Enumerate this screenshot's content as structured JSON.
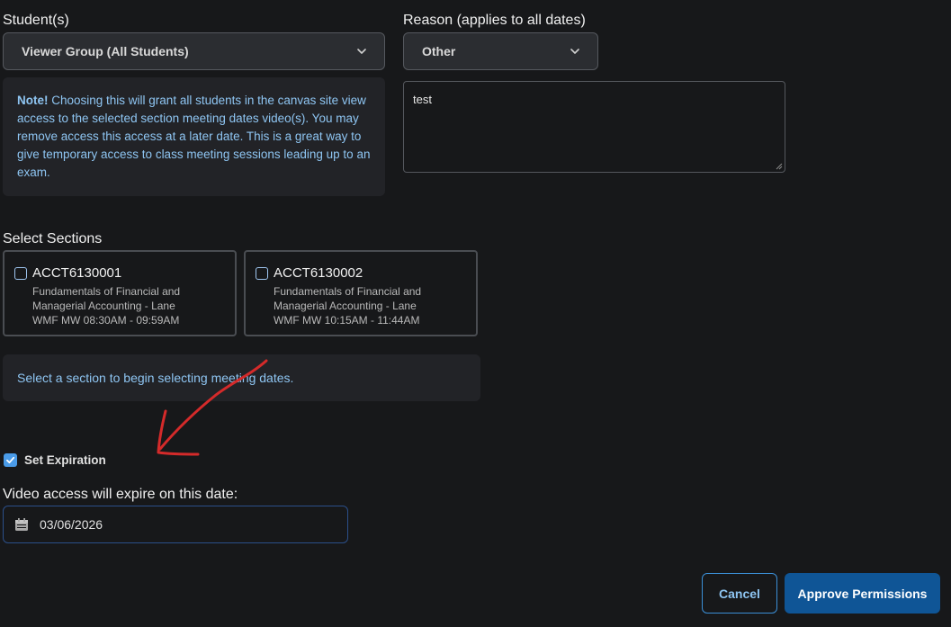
{
  "students": {
    "label": "Student(s)",
    "selected": "Viewer Group (All Students)",
    "note_strong": "Note!",
    "note_text": " Choosing this will grant all students in the canvas site view access to the selected section meeting dates video(s). You may remove access this access at a later date. This is a great way to give temporary access to class meeting sessions leading up to an exam."
  },
  "reason": {
    "label": "Reason (applies to all dates)",
    "selected": "Other",
    "text": "test"
  },
  "sections": {
    "label": "Select Sections",
    "items": [
      {
        "code": "ACCT6130001",
        "line1": "Fundamentals of Financial and",
        "line2": "Managerial Accounting - Lane",
        "line3": "WMF MW 08:30AM - 09:59AM"
      },
      {
        "code": "ACCT6130002",
        "line1": "Fundamentals of Financial and",
        "line2": "Managerial Accounting - Lane",
        "line3": "WMF MW 10:15AM - 11:44AM"
      }
    ],
    "info": "Select a section to begin selecting meeting dates."
  },
  "expiration": {
    "checkbox_label": "Set Expiration",
    "date_label": "Video access will expire on this date:",
    "date_value": "03/06/2026"
  },
  "actions": {
    "cancel": "Cancel",
    "approve": "Approve Permissions"
  },
  "colors": {
    "background": "#17181a",
    "accent": "#0f5596",
    "link": "#8ec5f2",
    "annotation": "#d42a2a"
  },
  "icons": [
    "chevron-down-icon",
    "calendar-icon",
    "checkmark-icon",
    "annotation-arrow"
  ]
}
